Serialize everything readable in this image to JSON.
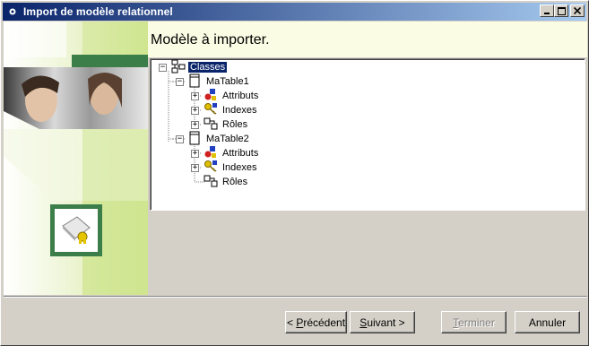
{
  "window": {
    "title": "Import de modèle relationnel",
    "controls": {
      "minimize": "_",
      "maximize": "□",
      "close": "×"
    }
  },
  "header": {
    "title": "Modèle à importer."
  },
  "tree": {
    "root": {
      "label": "Classes",
      "icon": "classes-icon",
      "expanded": true,
      "selected": true
    },
    "tables": [
      {
        "label": "MaTable1",
        "icon": "table-icon",
        "expanded": true,
        "children": [
          {
            "label": "Attributs",
            "icon": "attributes-icon",
            "expandable": true
          },
          {
            "label": "Indexes",
            "icon": "key-icon",
            "expandable": true
          },
          {
            "label": "Rôles",
            "icon": "roles-icon",
            "expandable": true
          }
        ]
      },
      {
        "label": "MaTable2",
        "icon": "table-icon",
        "expanded": true,
        "children": [
          {
            "label": "Attributs",
            "icon": "attributes-icon",
            "expandable": true
          },
          {
            "label": "Indexes",
            "icon": "key-icon",
            "expandable": true
          },
          {
            "label": "Rôles",
            "icon": "roles-icon",
            "expandable": false
          }
        ]
      }
    ]
  },
  "buttons": {
    "back": {
      "prefix": "< ",
      "mnemonic": "P",
      "rest": "récédent"
    },
    "next": {
      "mnemonic": "S",
      "rest": "uivant >"
    },
    "finish": {
      "mnemonic": "T",
      "rest": "erminer",
      "enabled": false
    },
    "cancel": {
      "label": "Annuler"
    }
  },
  "colors": {
    "title_gradient_start": "#0a246a",
    "title_gradient_end": "#a6caf0",
    "header_bg": "#fbfce4",
    "dialog_bg": "#d4d0c8",
    "accent_green": "#3c7e4a",
    "light_green": "#cce38a"
  }
}
